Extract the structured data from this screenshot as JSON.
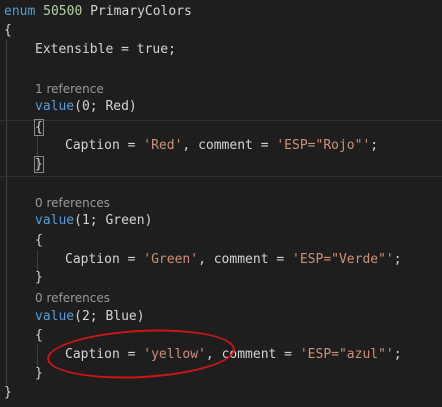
{
  "code": {
    "line1": {
      "kw": "enum",
      "num": "50500",
      "name": "PrimaryColors"
    },
    "open_brace": "{",
    "close_brace": "}",
    "prop": {
      "name": "Extensible",
      "eq": " = ",
      "val": "true",
      "end": ";"
    },
    "values": [
      {
        "codelens": "1 reference",
        "kw": "value",
        "args": "(0; Red)",
        "open": "{",
        "close": "}",
        "caption_kw": "Caption",
        "caption_val": "'Red'",
        "comment_kw": "comment",
        "comment_val": "'ESP=\"Rojo\"'"
      },
      {
        "codelens": "0 references",
        "kw": "value",
        "args": "(1; Green)",
        "open": "{",
        "close": "}",
        "caption_kw": "Caption",
        "caption_val": "'Green'",
        "comment_kw": "comment",
        "comment_val": "'ESP=\"Verde\"'"
      },
      {
        "codelens": "0 references",
        "kw": "value",
        "args": "(2; Blue)",
        "open": "{",
        "close": "}",
        "caption_kw": "Caption",
        "caption_val": "'yellow'",
        "comment_kw": "comment",
        "comment_val": "'ESP=\"azul\"'"
      }
    ]
  },
  "colors": {
    "keyword": "#569cd6",
    "string": "#ce9178",
    "number": "#b5cea8",
    "text": "#d4d4d4",
    "codelens": "#999999",
    "annotation": "#d01515"
  }
}
